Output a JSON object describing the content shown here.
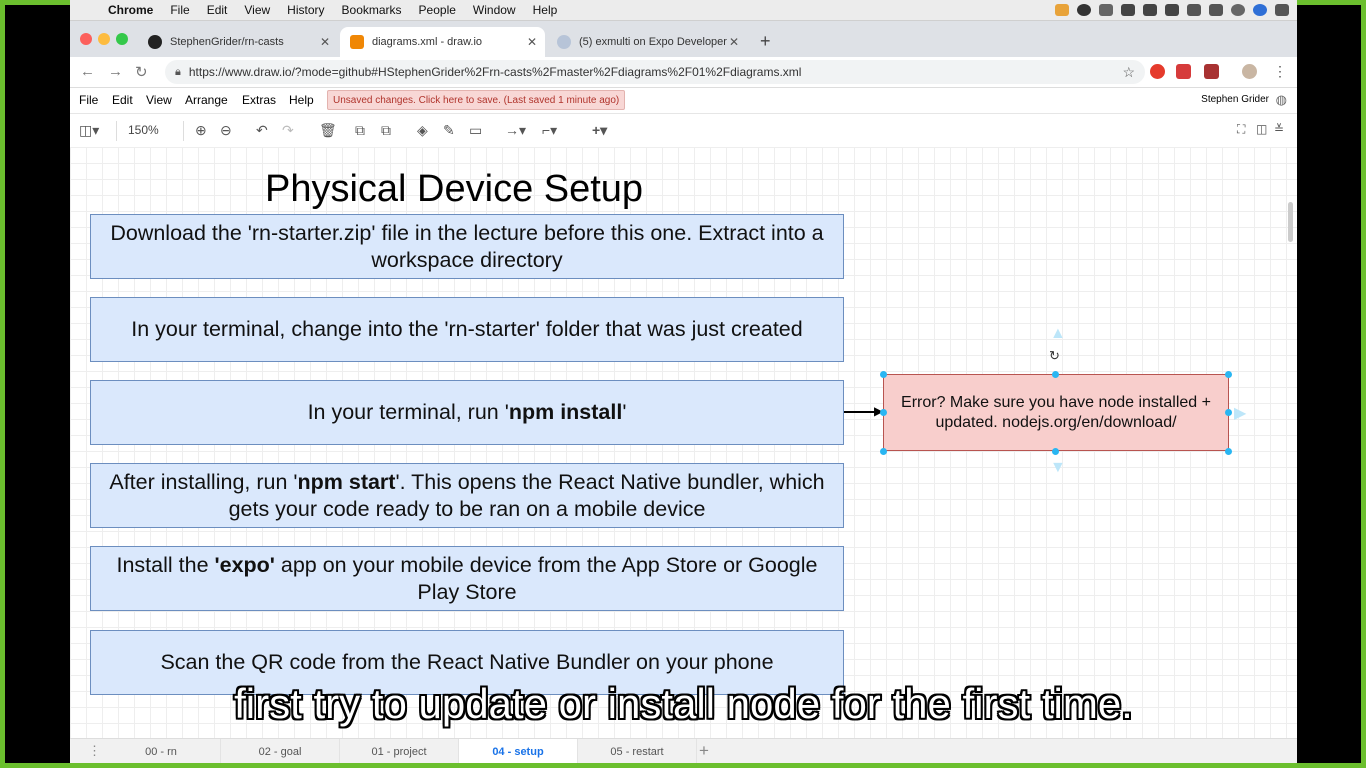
{
  "mac_menu": {
    "app_name": "Chrome",
    "items": [
      "File",
      "Edit",
      "View",
      "History",
      "Bookmarks",
      "People",
      "Window",
      "Help"
    ]
  },
  "tabs": [
    {
      "title": "StephenGrider/rn-casts",
      "icon": "github-icon",
      "active": false
    },
    {
      "title": "diagrams.xml - draw.io",
      "icon": "drawio-icon",
      "active": true
    },
    {
      "title": "(5) exmulti on Expo Developer",
      "icon": "expo-icon",
      "active": false
    }
  ],
  "address_bar": {
    "url": "https://www.draw.io/?mode=github#HStephenGrider%2Frn-casts%2Fmaster%2Fdiagrams%2F01%2Fdiagrams.xml"
  },
  "drawio_menu": {
    "items": [
      "File",
      "Edit",
      "View",
      "Arrange",
      "Extras",
      "Help"
    ],
    "unsaved": "Unsaved changes. Click here to save. (Last saved 1 minute ago)",
    "user": "Stephen Grider"
  },
  "toolbar": {
    "zoom": "150%"
  },
  "diagram": {
    "title": "Physical Device Setup",
    "steps": [
      {
        "pre": "Download the 'rn-starter.zip' file in the lecture before this one.  Extract into a workspace directory",
        "bold": "",
        "post": ""
      },
      {
        "pre": "In your terminal, change into the 'rn-starter' folder that was just created",
        "bold": "",
        "post": ""
      },
      {
        "pre": "In your terminal, run '",
        "bold": "npm install",
        "post": "'"
      },
      {
        "pre": "After installing, run '",
        "bold": "npm start",
        "post": "'.  This opens the React Native bundler, which gets your code ready to be ran on a mobile device"
      },
      {
        "pre": "Install the ",
        "bold": "'expo'",
        "post": " app on your mobile device from the App Store or Google Play Store"
      },
      {
        "pre": "Scan the QR code from the React Native Bundler on your phone",
        "bold": "",
        "post": ""
      }
    ],
    "error_note": "Error? Make sure you have node installed + updated.  nodejs.org/en/download/"
  },
  "subtitle": "first try to update or install node for the first time.",
  "pages": [
    "00 - rn",
    "02 - goal",
    "01 - project",
    "04 - setup",
    "05 - restart"
  ],
  "active_page": "04 - setup"
}
